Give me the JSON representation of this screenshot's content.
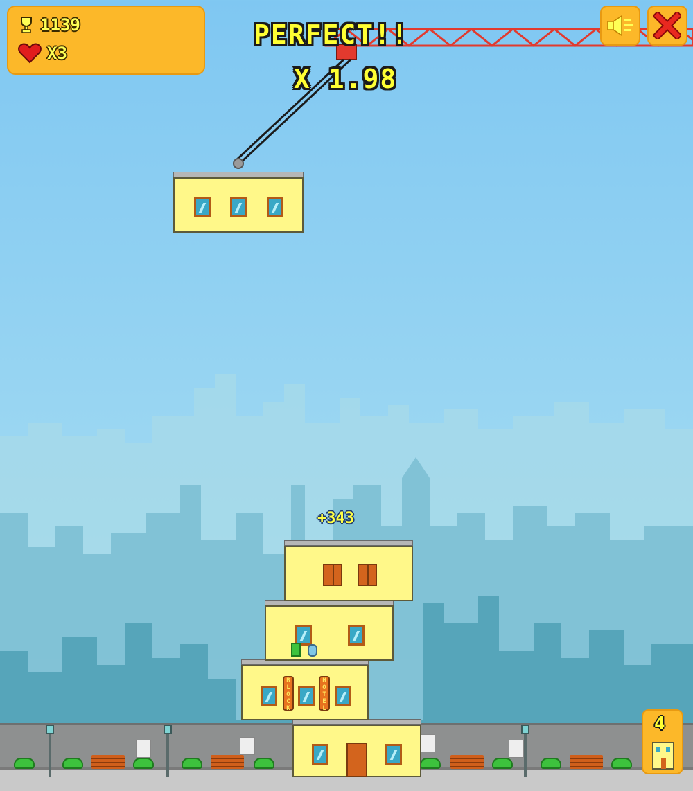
{
  "hud": {
    "score": "1139",
    "lives": "X3"
  },
  "controls": {
    "sound_icon": "speaker-icon",
    "close_icon": "close-x-icon"
  },
  "feedback": {
    "message": "PERFECT!!",
    "multiplier": "X 1.98",
    "points_popup": "+343"
  },
  "tower": {
    "signs": [
      "BLOCK",
      "HOTEL"
    ]
  },
  "floor_counter": {
    "count": "4"
  },
  "colors": {
    "sky_top": "#7fc7f2",
    "hud_orange": "#fcb829",
    "building_yellow": "#fff889",
    "crane_red": "#e23a2e",
    "text_yellow": "#ffff33"
  }
}
